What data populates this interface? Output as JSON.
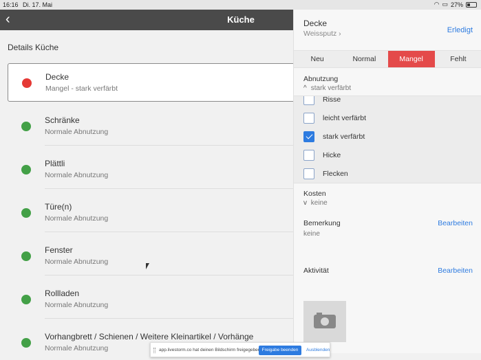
{
  "statusbar": {
    "time": "16:16",
    "date": "Di. 17. Mai",
    "battery": "27%"
  },
  "nav": {
    "title": "Küche"
  },
  "main": {
    "section_title": "Details Küche",
    "items": [
      {
        "name": "Decke",
        "sub": "Mangel - stark verfärbt",
        "status_color": "#e53935"
      },
      {
        "name": "Schränke",
        "sub": "Normale Abnutzung",
        "status_color": "#43a047"
      },
      {
        "name": "Plättli",
        "sub": "Normale Abnutzung",
        "status_color": "#43a047"
      },
      {
        "name": "Türe(n)",
        "sub": "Normale Abnutzung",
        "status_color": "#43a047"
      },
      {
        "name": "Fenster",
        "sub": "Normale Abnutzung",
        "status_color": "#43a047"
      },
      {
        "name": "Rollladen",
        "sub": "Normale Abnutzung",
        "status_color": "#43a047"
      },
      {
        "name": "Vorhangbrett / Schienen / Weitere Kleinartikel / Vorhänge",
        "sub": "Normale Abnutzung",
        "status_color": "#43a047"
      }
    ]
  },
  "panel": {
    "title": "Decke",
    "subtitle": "Weissputz",
    "done_label": "Erledigt",
    "segments": [
      "Neu",
      "Normal",
      "Mangel",
      "Fehlt"
    ],
    "active_segment": "Mangel",
    "wear_label": "Abnutzung",
    "wear_value": "stark verfärbt",
    "options": [
      {
        "label": "Risse",
        "checked": false
      },
      {
        "label": "leicht verfärbt",
        "checked": false
      },
      {
        "label": "stark verfärbt",
        "checked": true
      },
      {
        "label": "Hicke",
        "checked": false
      },
      {
        "label": "Flecken",
        "checked": false
      }
    ],
    "costs_label": "Kosten",
    "costs_value": "keine",
    "remark_label": "Bemerkung",
    "remark_edit": "Bearbeiten",
    "remark_value": "keine",
    "activity_label": "Aktivität",
    "activity_edit": "Bearbeiten"
  },
  "banner": {
    "message": "app.livestorm.co hat deinen Bildschirm freigegeben.",
    "stop_label": "Freigabe beenden",
    "hide_label": "Ausblenden"
  },
  "colors": {
    "accent": "#2d7be0",
    "defect": "#e44a4a",
    "ok": "#43a047"
  }
}
